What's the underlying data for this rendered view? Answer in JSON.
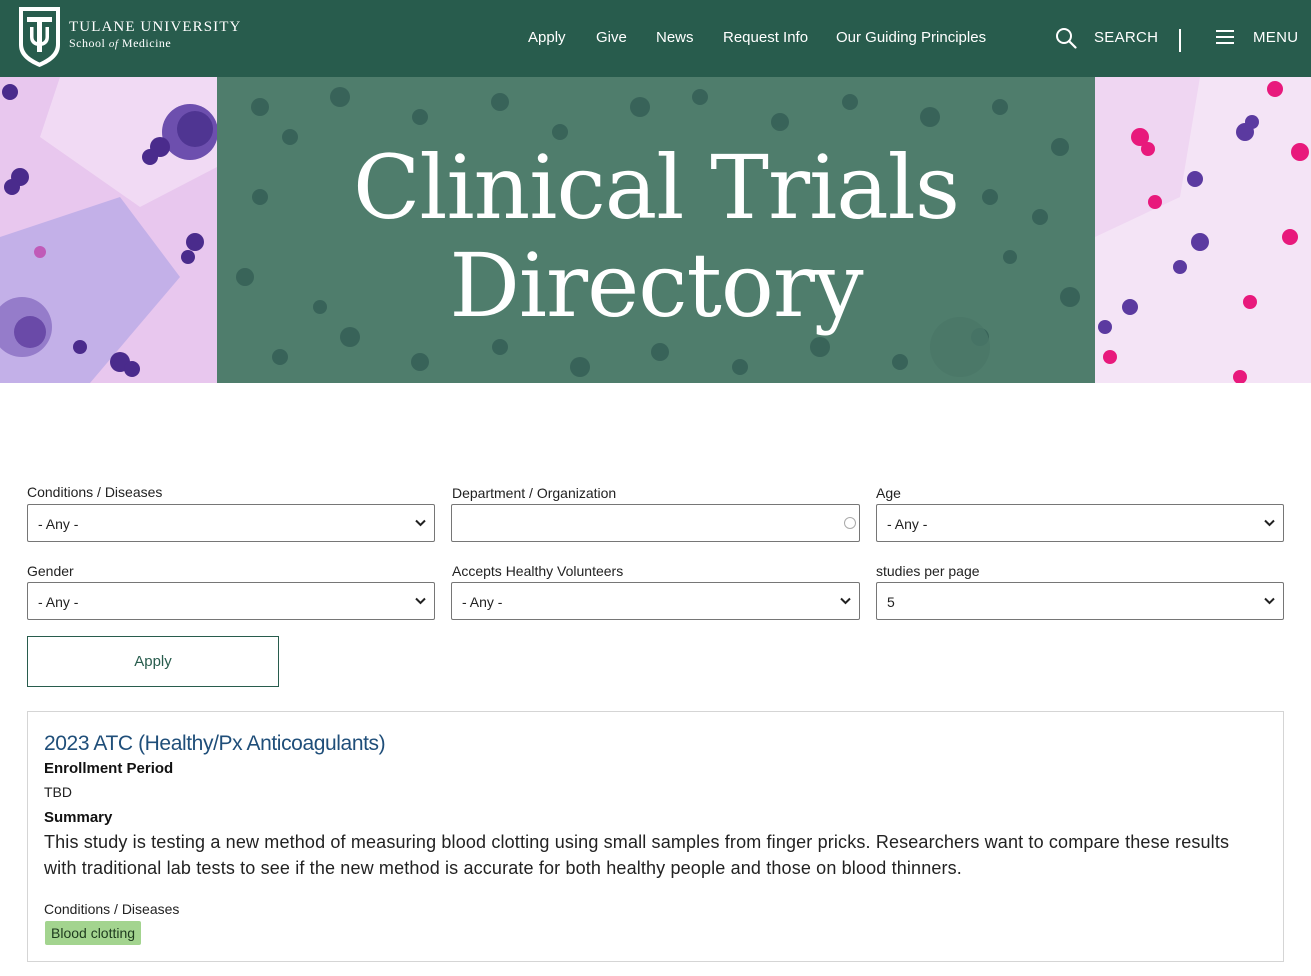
{
  "header": {
    "logo": {
      "university": "TULANE UNIVERSITY",
      "school_a": "School",
      "school_of": "of",
      "school_b": "Medicine"
    },
    "nav": [
      {
        "label": "Apply"
      },
      {
        "label": "Give"
      },
      {
        "label": "News"
      },
      {
        "label": "Request Info"
      },
      {
        "label": "Our Guiding Principles"
      }
    ],
    "search_label": "SEARCH",
    "menu_label": "MENU",
    "bg_color": "#285c4d"
  },
  "hero": {
    "title_line1": "Clinical Trials",
    "title_line2": "Directory"
  },
  "filters": {
    "conditions": {
      "label": "Conditions / Diseases",
      "value": "- Any -"
    },
    "department": {
      "label": "Department / Organization",
      "value": ""
    },
    "age": {
      "label": "Age",
      "value": "- Any -"
    },
    "gender": {
      "label": "Gender",
      "value": "- Any -"
    },
    "healthy": {
      "label": "Accepts Healthy Volunteers",
      "value": "- Any -"
    },
    "per_page": {
      "label": "studies per page",
      "value": "5"
    },
    "apply_label": "Apply"
  },
  "results": [
    {
      "title": "2023 ATC (Healthy/Px Anticoagulants)",
      "enrollment_heading": "Enrollment Period",
      "enrollment_value": "TBD",
      "summary_heading": "Summary",
      "summary": "This study is testing a new method of measuring blood clotting using small samples from finger pricks. Researchers want to compare these results with traditional lab tests to see if the new method is accurate for both healthy people and those on blood thinners.",
      "conditions_heading": "Conditions / Diseases",
      "conditions": [
        "Blood clotting"
      ]
    }
  ],
  "colors": {
    "accent": "#285c4d",
    "link": "#1f4e79",
    "tag": "#a3d48f"
  }
}
